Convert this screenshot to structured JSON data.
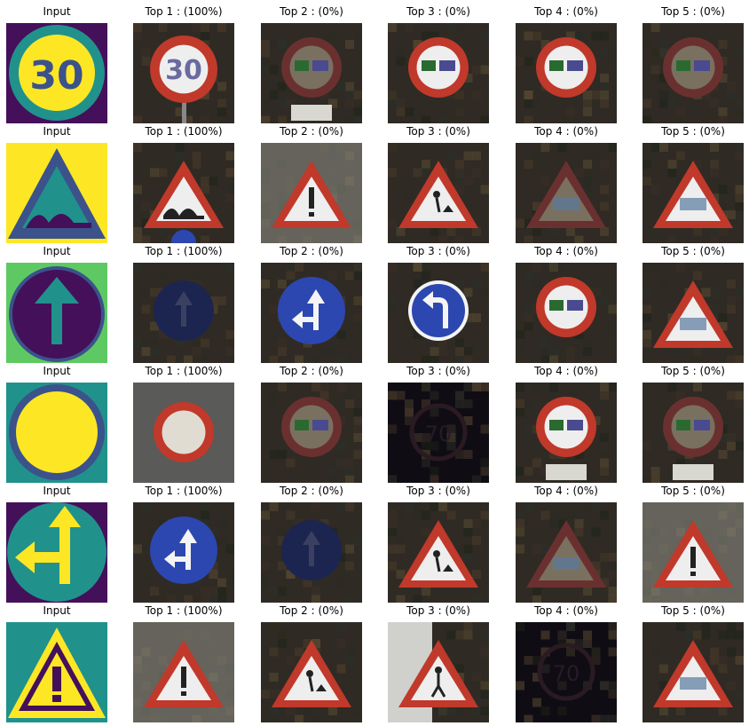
{
  "figure": {
    "rows": [
      {
        "cells": [
          {
            "title": "Input",
            "image": "speed-limit-30-sign-icon",
            "kind": "input",
            "palette": "viridis"
          },
          {
            "title": "Top 1 : (100%)",
            "image": "speed-limit-30-sign-photo-icon",
            "kind": "photo"
          },
          {
            "title": "Top 2 : (0%)",
            "image": "no-overtaking-trucks-sign-photo-icon",
            "kind": "photo"
          },
          {
            "title": "Top 3 : (0%)",
            "image": "no-overtaking-sign-photo-icon",
            "kind": "photo"
          },
          {
            "title": "Top 4 : (0%)",
            "image": "no-overtaking-sign-photo-icon",
            "kind": "photo"
          },
          {
            "title": "Top 5 : (0%)",
            "image": "no-overtaking-sign-photo-icon",
            "kind": "photo"
          }
        ]
      },
      {
        "cells": [
          {
            "title": "Input",
            "image": "bumpy-road-sign-icon",
            "kind": "input",
            "palette": "viridis"
          },
          {
            "title": "Top 1 : (100%)",
            "image": "bumpy-road-sign-photo-icon",
            "kind": "photo"
          },
          {
            "title": "Top 2 : (0%)",
            "image": "general-caution-sign-photo-icon",
            "kind": "photo"
          },
          {
            "title": "Top 3 : (0%)",
            "image": "road-work-sign-photo-icon",
            "kind": "photo"
          },
          {
            "title": "Top 4 : (0%)",
            "image": "warning-triangle-sign-photo-icon",
            "kind": "photo"
          },
          {
            "title": "Top 5 : (0%)",
            "image": "warning-triangle-sign-photo-icon",
            "kind": "photo"
          }
        ]
      },
      {
        "cells": [
          {
            "title": "Input",
            "image": "ahead-only-sign-icon",
            "kind": "input",
            "palette": "viridis"
          },
          {
            "title": "Top 1 : (100%)",
            "image": "ahead-only-sign-photo-icon",
            "kind": "photo"
          },
          {
            "title": "Top 2 : (0%)",
            "image": "go-straight-or-left-sign-photo-icon",
            "kind": "photo"
          },
          {
            "title": "Top 3 : (0%)",
            "image": "turn-left-ahead-sign-photo-icon",
            "kind": "photo"
          },
          {
            "title": "Top 4 : (0%)",
            "image": "no-overtaking-sign-photo-icon",
            "kind": "photo"
          },
          {
            "title": "Top 5 : (0%)",
            "image": "warning-triangle-sign-photo-icon",
            "kind": "photo"
          }
        ]
      },
      {
        "cells": [
          {
            "title": "Input",
            "image": "no-vehicles-sign-icon",
            "kind": "input",
            "palette": "viridis"
          },
          {
            "title": "Top 1 : (100%)",
            "image": "no-vehicles-sign-photo-icon",
            "kind": "photo"
          },
          {
            "title": "Top 2 : (0%)",
            "image": "no-overtaking-sign-photo-icon",
            "kind": "photo"
          },
          {
            "title": "Top 3 : (0%)",
            "image": "speed-limit-70-sign-photo-icon",
            "kind": "photo"
          },
          {
            "title": "Top 4 : (0%)",
            "image": "no-overtaking-trucks-sign-photo-icon",
            "kind": "photo"
          },
          {
            "title": "Top 5 : (0%)",
            "image": "no-overtaking-trucks-sign-photo-icon",
            "kind": "photo"
          }
        ]
      },
      {
        "cells": [
          {
            "title": "Input",
            "image": "go-straight-or-left-sign-icon",
            "kind": "input",
            "palette": "viridis"
          },
          {
            "title": "Top 1 : (100%)",
            "image": "go-straight-or-left-sign-photo-icon",
            "kind": "photo"
          },
          {
            "title": "Top 2 : (0%)",
            "image": "ahead-only-sign-photo-icon",
            "kind": "photo"
          },
          {
            "title": "Top 3 : (0%)",
            "image": "road-work-sign-photo-icon",
            "kind": "photo"
          },
          {
            "title": "Top 4 : (0%)",
            "image": "warning-triangle-sign-photo-icon",
            "kind": "photo"
          },
          {
            "title": "Top 5 : (0%)",
            "image": "general-caution-sign-photo-icon",
            "kind": "photo"
          }
        ]
      },
      {
        "cells": [
          {
            "title": "Input",
            "image": "general-caution-sign-icon",
            "kind": "input",
            "palette": "viridis"
          },
          {
            "title": "Top 1 : (100%)",
            "image": "general-caution-sign-photo-icon",
            "kind": "photo"
          },
          {
            "title": "Top 2 : (0%)",
            "image": "road-work-sign-photo-icon",
            "kind": "photo"
          },
          {
            "title": "Top 3 : (0%)",
            "image": "pedestrians-sign-photo-icon",
            "kind": "photo"
          },
          {
            "title": "Top 4 : (0%)",
            "image": "speed-limit-70-sign-photo-icon",
            "kind": "photo"
          },
          {
            "title": "Top 5 : (0%)",
            "image": "warning-triangle-sign-photo-icon",
            "kind": "photo"
          }
        ]
      }
    ]
  },
  "colors": {
    "viridis_purple": "#44105a",
    "viridis_blue": "#3b528b",
    "viridis_teal": "#21918c",
    "viridis_green": "#5ec962",
    "viridis_yellow": "#fde725",
    "sign_red": "#c0392b",
    "sign_blue": "#2c47b0",
    "sign_white": "#eeeeee"
  }
}
